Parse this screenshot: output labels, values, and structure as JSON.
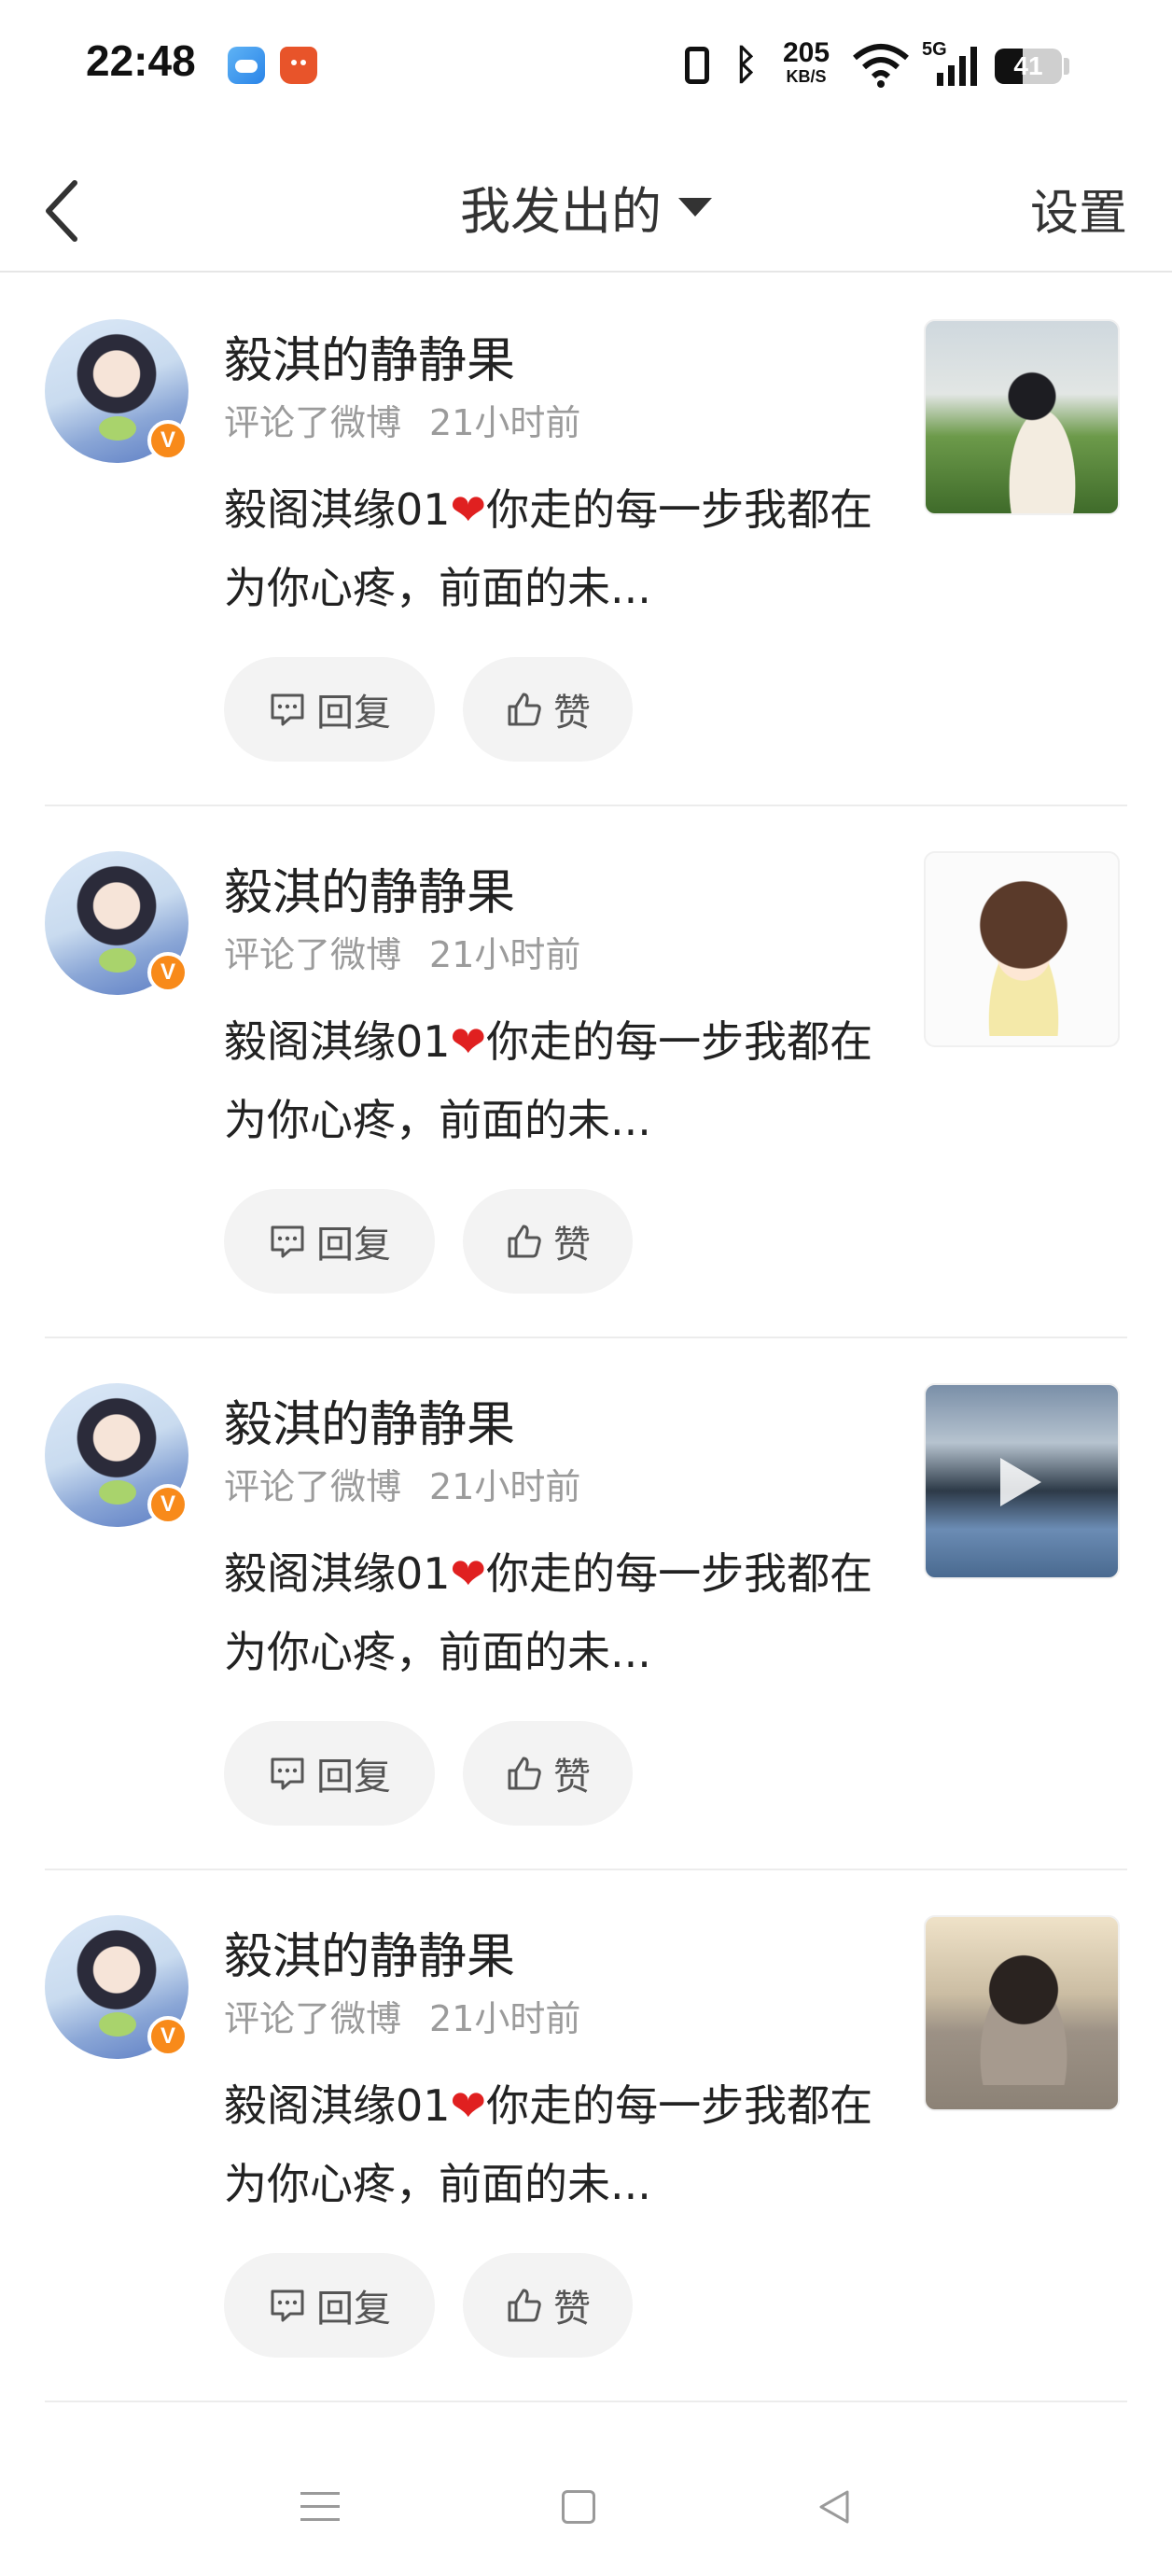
{
  "status_bar": {
    "time": "22:48",
    "speed_value": "205",
    "speed_unit": "KB/S",
    "network": "5G",
    "battery_level": "41",
    "battery_percent": 41,
    "icons": [
      "weather-icon",
      "shopping-bag-icon",
      "vibrate-icon",
      "bluetooth-icon",
      "wifi-icon",
      "signal-icon",
      "battery-icon"
    ]
  },
  "header": {
    "title": "我发出的",
    "settings_label": "设置",
    "back_icon": "chevron-left-icon",
    "dropdown_icon": "caret-down-icon"
  },
  "feed": {
    "items": [
      {
        "author": "毅淇的静静果",
        "action": "评论了微博",
        "time": "21小时前",
        "text_before": "毅阁淇缘01",
        "heart": "❤",
        "text_after": "你走的每一步我都在为你心疼，前面的未...",
        "reply_label": "回复",
        "like_label": "赞",
        "verified_badge": "V",
        "thumbnail": "photo"
      },
      {
        "author": "毅淇的静静果",
        "action": "评论了微博",
        "time": "21小时前",
        "text_before": "毅阁淇缘01",
        "heart": "❤",
        "text_after": "你走的每一步我都在为你心疼，前面的未...",
        "reply_label": "回复",
        "like_label": "赞",
        "verified_badge": "V",
        "thumbnail": "cartoon"
      },
      {
        "author": "毅淇的静静果",
        "action": "评论了微博",
        "time": "21小时前",
        "text_before": "毅阁淇缘01",
        "heart": "❤",
        "text_after": "你走的每一步我都在为你心疼，前面的未...",
        "reply_label": "回复",
        "like_label": "赞",
        "verified_badge": "V",
        "thumbnail": "video"
      },
      {
        "author": "毅淇的静静果",
        "action": "评论了微博",
        "time": "21小时前",
        "text_before": "毅阁淇缘01",
        "heart": "❤",
        "text_after": "你走的每一步我都在为你心疼，前面的未...",
        "reply_label": "回复",
        "like_label": "赞",
        "verified_badge": "V",
        "thumbnail": "photo"
      }
    ]
  },
  "nav_bar": {
    "icons": [
      "menu-icon",
      "home-square-icon",
      "back-triangle-icon"
    ]
  },
  "colors": {
    "badge": "#f88a1a",
    "heart": "#e02020",
    "text_primary": "#222222",
    "text_secondary": "#9b9b9b",
    "button_bg": "#f3f3f3"
  }
}
